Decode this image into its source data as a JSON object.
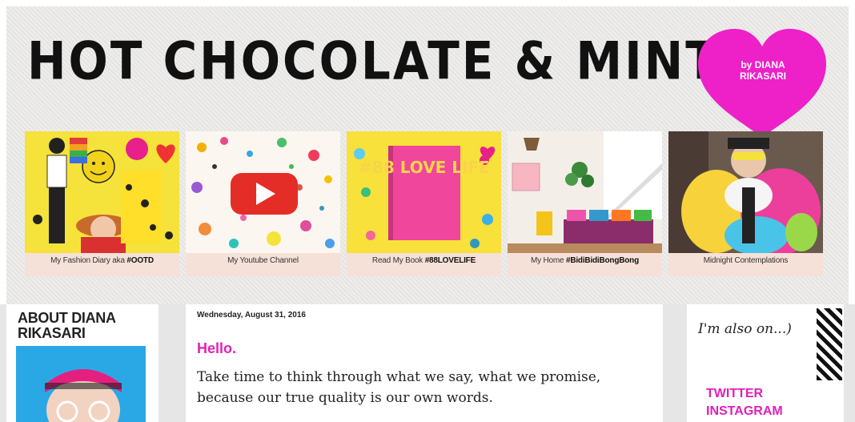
{
  "header": {
    "title": "HOT CHOCOLATE & MINT",
    "byline": "by DIANA RIKASARI",
    "accent_color": "#ee20c8"
  },
  "tiles": [
    {
      "caption_plain": "My Fashion Diary aka ",
      "caption_bold": "#OOTD"
    },
    {
      "caption_plain": "My Youtube Channel",
      "caption_bold": ""
    },
    {
      "caption_plain": "Read My Book ",
      "caption_bold": "#88LOVELIFE",
      "book_text": "#88 LOVE LIFE"
    },
    {
      "caption_plain": "My Home ",
      "caption_bold": "#BidiBidiBongBong"
    },
    {
      "caption_plain": "Midnight Contemplations",
      "caption_bold": ""
    }
  ],
  "sidebar_left": {
    "title": "ABOUT DIANA RIKASARI"
  },
  "post": {
    "date": "Wednesday, August 31, 2016",
    "title": "Hello.",
    "body": "Take time to think through what we say, what we promise, because our true quality is our own words."
  },
  "sidebar_right": {
    "also_on": "I'm also on...)",
    "links": [
      "TWITTER",
      "INSTAGRAM"
    ]
  }
}
